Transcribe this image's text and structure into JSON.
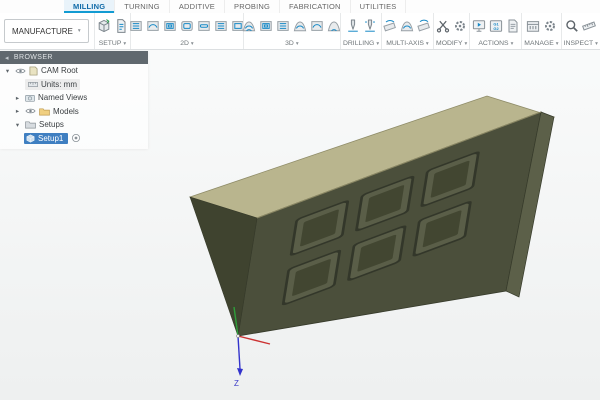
{
  "workspace_button": {
    "label": "MANUFACTURE"
  },
  "tabs": [
    {
      "label": "MILLING",
      "active": true
    },
    {
      "label": "TURNING"
    },
    {
      "label": "ADDITIVE"
    },
    {
      "label": "PROBING"
    },
    {
      "label": "FABRICATION"
    },
    {
      "label": "UTILITIES"
    }
  ],
  "toolbar": {
    "groups": [
      {
        "label": "SETUP",
        "icons": [
          "new-setup-icon",
          "nc-program-icon"
        ]
      },
      {
        "label": "2D",
        "icons": [
          "2d-face-icon",
          "2d-adaptive-icon",
          "2d-pocket-icon",
          "2d-contour-icon",
          "2d-slot-icon",
          "2d-trace-icon",
          "2d-engrave-icon"
        ]
      },
      {
        "label": "3D",
        "icons": [
          "3d-adaptive-icon",
          "3d-pocket-icon",
          "3d-parallel-icon",
          "3d-contour-icon",
          "3d-ramp-icon",
          "3d-scallop-icon"
        ]
      },
      {
        "label": "DRILLING",
        "icons": [
          "drill-icon",
          "bore-icon"
        ]
      },
      {
        "label": "MULTI-AXIS",
        "icons": [
          "swarf-icon",
          "multi-axis-contour-icon",
          "flow-icon"
        ]
      },
      {
        "label": "MODIFY",
        "icons": [
          "trim-toolpath-icon",
          "edit-toolpath-icon"
        ]
      },
      {
        "label": "ACTIONS",
        "icons": [
          "simulate-icon",
          "post-process-icon",
          "setup-sheet-icon"
        ]
      },
      {
        "label": "MANAGE",
        "icons": [
          "tool-library-icon",
          "task-manager-icon"
        ]
      },
      {
        "label": "INSPECT",
        "icons": [
          "measure-icon",
          "section-analysis-icon"
        ]
      }
    ]
  },
  "browser": {
    "title": "BROWSER",
    "items": [
      {
        "label": "CAM Root",
        "expanded": true,
        "visible": true
      },
      {
        "label": "Units: mm"
      },
      {
        "label": "Named Views",
        "collapsed": true
      },
      {
        "label": "Models",
        "collapsed": true,
        "visible": true
      },
      {
        "label": "Setups",
        "expanded": true
      },
      {
        "label": "Setup1",
        "selected": true,
        "active": true
      }
    ]
  },
  "viewport": {
    "axis_label": "Z",
    "part_colors": {
      "top_face": "#4b4f3b",
      "light_face": "#b9b58e",
      "end_face": "#5c6049",
      "pocket_rim": "#33372a",
      "pocket_bottom": "#424631"
    },
    "triad_colors": {
      "x": "#cc3333",
      "y": "#2e9e3a",
      "z": "#3333cc"
    }
  }
}
